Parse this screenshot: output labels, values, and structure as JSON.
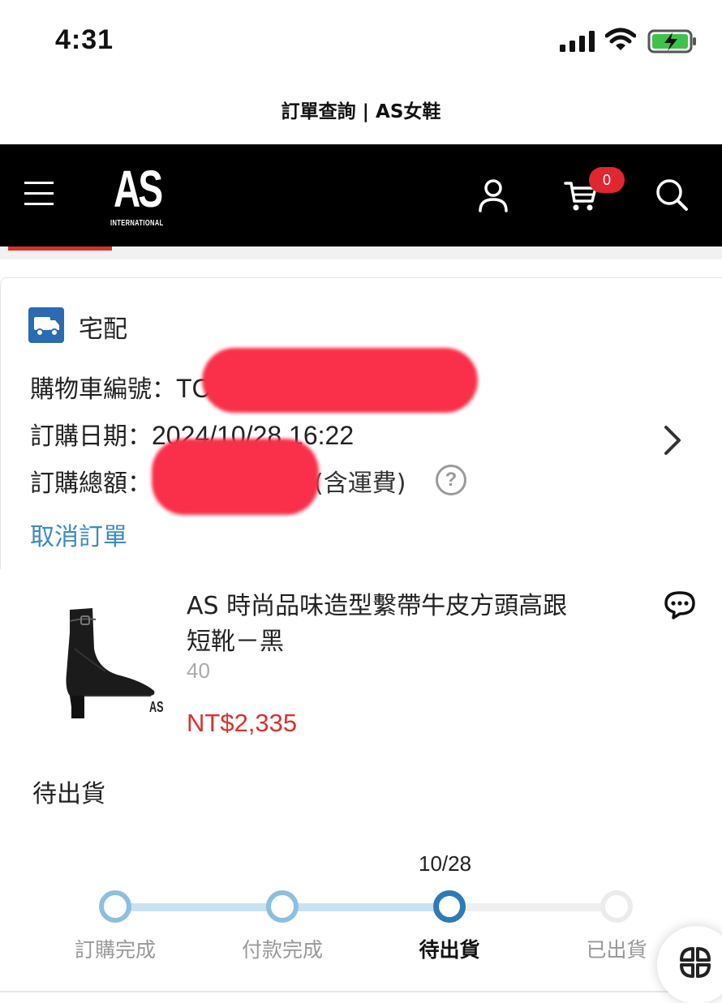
{
  "status_bar": {
    "time": "4:31"
  },
  "page": {
    "title": "訂單查詢 | AS女鞋"
  },
  "header": {
    "logo_main": "AS",
    "logo_sub": "INTERNATIONAL",
    "cart_count": "0"
  },
  "order": {
    "delivery_method": "宅配",
    "cart_number_label": "購物車編號：",
    "cart_number_value": "TC",
    "date_label": "訂購日期：",
    "date_value": "2024/10/28 16:22",
    "total_label": "訂購總額：",
    "total_note": "(含運費)",
    "help_icon_glyph": "?",
    "cancel_label": "取消訂單"
  },
  "product": {
    "name": "AS 時尚品味造型繫帶牛皮方頭高跟短靴－黑",
    "size": "40",
    "price": "NT$2,335",
    "image_brand": "AS"
  },
  "status": {
    "current": "待出貨",
    "current_date": "10/28",
    "steps": [
      {
        "label": "訂購完成",
        "state": "done"
      },
      {
        "label": "付款完成",
        "state": "done"
      },
      {
        "label": "待出貨",
        "state": "current"
      },
      {
        "label": "已出貨",
        "state": "todo"
      }
    ]
  },
  "colors": {
    "accent_red": "#d9322b",
    "link_blue": "#3d8ac4",
    "step_blue": "#2d7ab8",
    "header_bg": "#000000"
  },
  "icons": [
    "signal-icon",
    "wifi-icon",
    "battery-charging-icon",
    "menu-icon",
    "user-icon",
    "cart-icon",
    "search-icon",
    "truck-icon",
    "help-icon",
    "chevron-right-icon",
    "chat-icon",
    "apps-icon"
  ]
}
